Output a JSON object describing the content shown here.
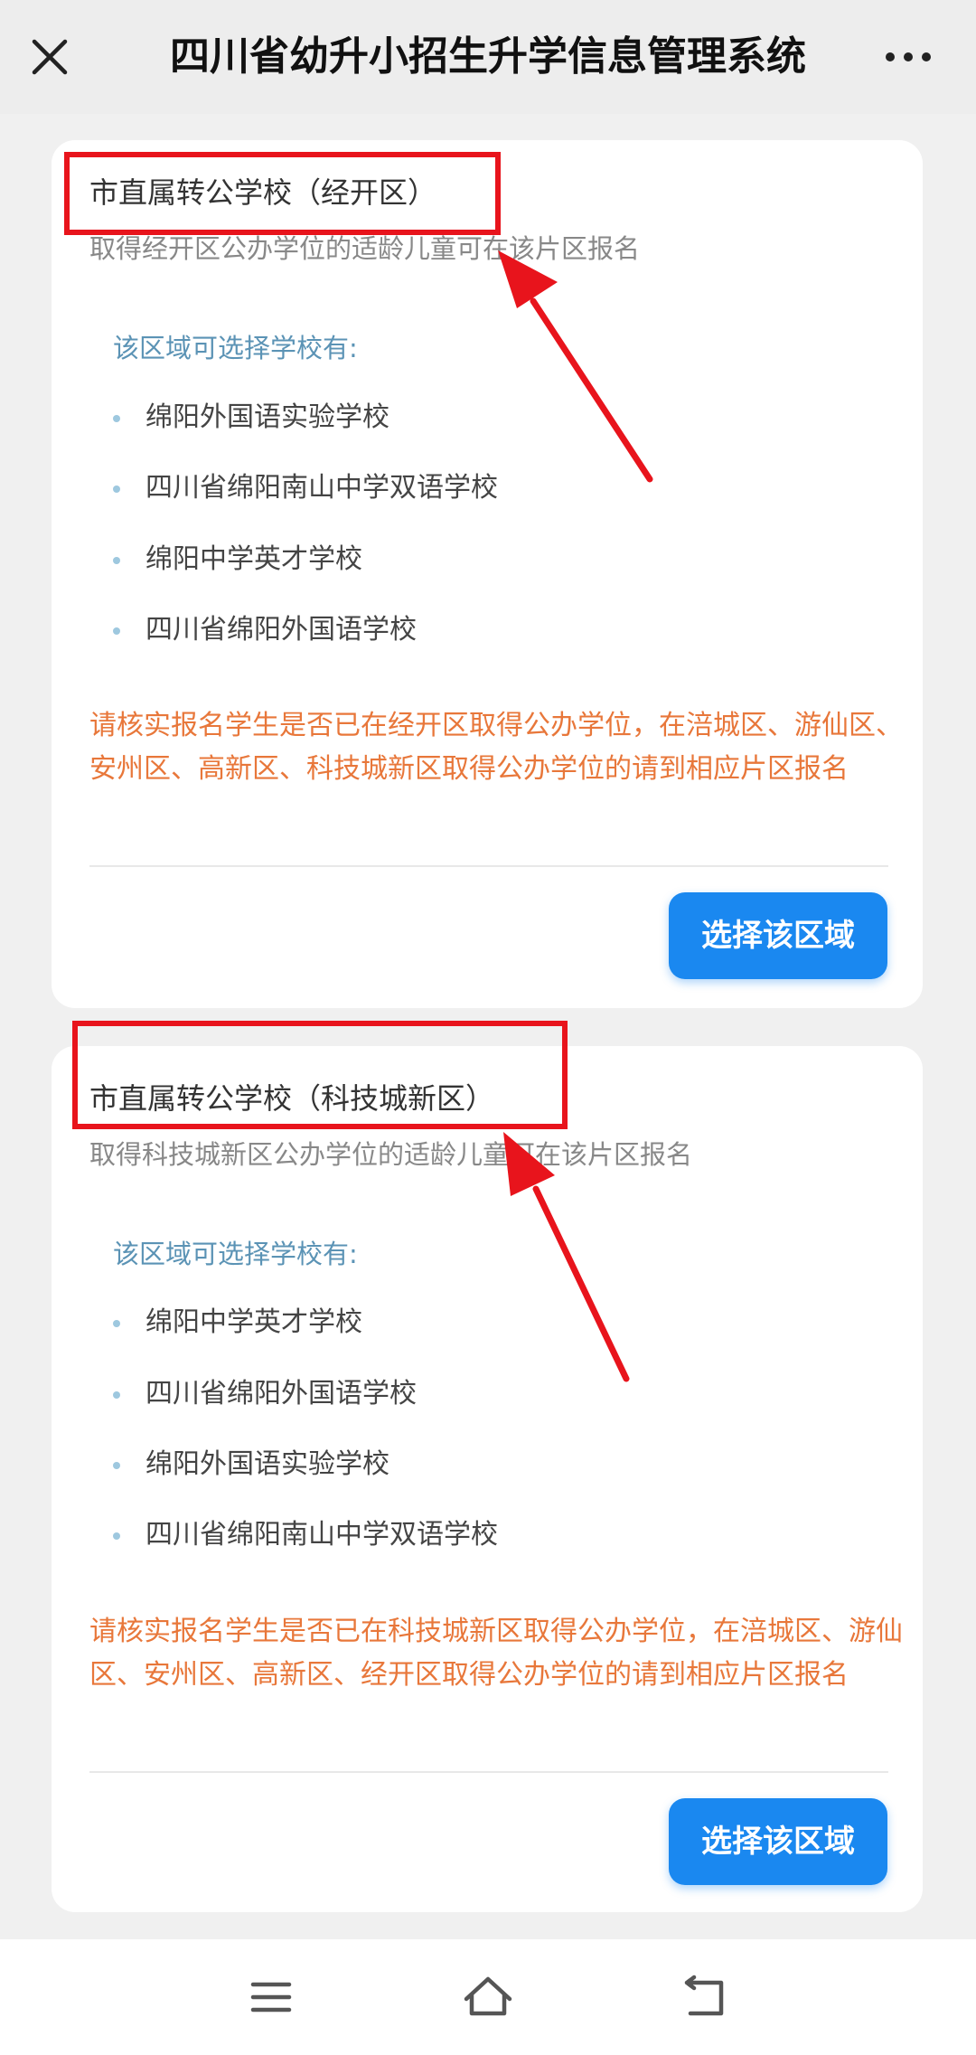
{
  "header": {
    "title": "四川省幼升小招生升学信息管理系统",
    "close_icon": "close-icon",
    "more_icon": "more-icon"
  },
  "cards": [
    {
      "title": "市直属转公学校（经开区）",
      "subtitle": "取得经开区公办学位的适龄儿童可在该片区报名",
      "schools_label": "该区域可选择学校有:",
      "schools": [
        "绵阳外国语实验学校",
        "四川省绵阳南山中学双语学校",
        "绵阳中学英才学校",
        "四川省绵阳外国语学校"
      ],
      "notice": "请核实报名学生是否已在经开区取得公办学位，在涪城区、游仙区、安州区、高新区、科技城新区取得公办学位的请到相应片区报名",
      "button": "选择该区域"
    },
    {
      "title": "市直属转公学校（科技城新区）",
      "subtitle": "取得科技城新区公办学位的适龄儿童可在该片区报名",
      "schools_label": "该区域可选择学校有:",
      "schools": [
        "绵阳中学英才学校",
        "四川省绵阳外国语学校",
        "绵阳外国语实验学校",
        "四川省绵阳南山中学双语学校"
      ],
      "notice": "请核实报名学生是否已在科技城新区取得公办学位，在涪城区、游仙区、安州区、高新区、经开区取得公办学位的请到相应片区报名",
      "button": "选择该区域"
    }
  ],
  "navbar": {
    "icons": [
      "menu-icon",
      "home-icon",
      "back-icon"
    ]
  },
  "colors": {
    "button": "#1a88f0",
    "notice": "#e8773a",
    "annotation": "#e8141c",
    "schools_label": "#5b93b5"
  }
}
